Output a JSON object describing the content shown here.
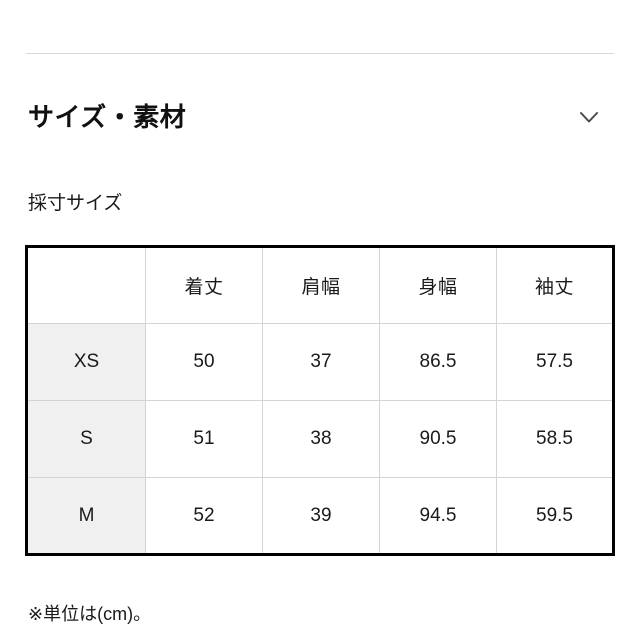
{
  "section": {
    "title": "サイズ・素材",
    "toggle_icon": "chevron-down-icon",
    "expanded": true
  },
  "subtitle": "採寸サイズ",
  "size_table": {
    "corner_header": "",
    "column_headers": [
      "着丈",
      "肩幅",
      "身幅",
      "袖丈"
    ],
    "rows": [
      {
        "size": "XS",
        "values": [
          "50",
          "37",
          "86.5",
          "57.5"
        ]
      },
      {
        "size": "S",
        "values": [
          "51",
          "38",
          "90.5",
          "58.5"
        ]
      },
      {
        "size": "M",
        "values": [
          "52",
          "39",
          "94.5",
          "59.5"
        ]
      }
    ]
  },
  "footnote": "※単位は(cm)。",
  "colors": {
    "text": "#1a1a1a",
    "table_outer_border": "#000000",
    "table_inner_border": "#d4d4d4",
    "size_cell_background": "#f0f0f0",
    "divider": "#d8d8d8",
    "background": "#ffffff"
  }
}
